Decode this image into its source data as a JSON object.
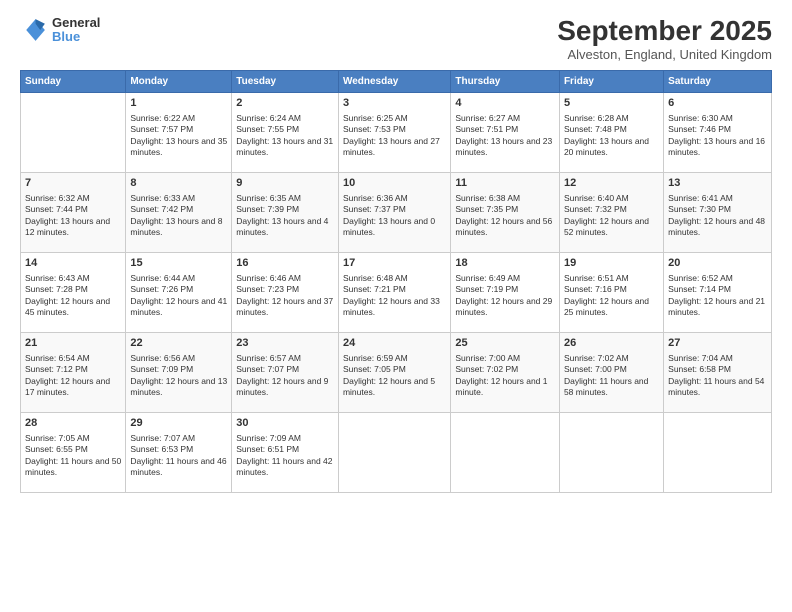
{
  "logo": {
    "line1": "General",
    "line2": "Blue"
  },
  "title": "September 2025",
  "subtitle": "Alveston, England, United Kingdom",
  "days_header": [
    "Sunday",
    "Monday",
    "Tuesday",
    "Wednesday",
    "Thursday",
    "Friday",
    "Saturday"
  ],
  "weeks": [
    [
      {
        "day": "",
        "sunrise": "",
        "sunset": "",
        "daylight": ""
      },
      {
        "day": "1",
        "sunrise": "Sunrise: 6:22 AM",
        "sunset": "Sunset: 7:57 PM",
        "daylight": "Daylight: 13 hours and 35 minutes."
      },
      {
        "day": "2",
        "sunrise": "Sunrise: 6:24 AM",
        "sunset": "Sunset: 7:55 PM",
        "daylight": "Daylight: 13 hours and 31 minutes."
      },
      {
        "day": "3",
        "sunrise": "Sunrise: 6:25 AM",
        "sunset": "Sunset: 7:53 PM",
        "daylight": "Daylight: 13 hours and 27 minutes."
      },
      {
        "day": "4",
        "sunrise": "Sunrise: 6:27 AM",
        "sunset": "Sunset: 7:51 PM",
        "daylight": "Daylight: 13 hours and 23 minutes."
      },
      {
        "day": "5",
        "sunrise": "Sunrise: 6:28 AM",
        "sunset": "Sunset: 7:48 PM",
        "daylight": "Daylight: 13 hours and 20 minutes."
      },
      {
        "day": "6",
        "sunrise": "Sunrise: 6:30 AM",
        "sunset": "Sunset: 7:46 PM",
        "daylight": "Daylight: 13 hours and 16 minutes."
      }
    ],
    [
      {
        "day": "7",
        "sunrise": "Sunrise: 6:32 AM",
        "sunset": "Sunset: 7:44 PM",
        "daylight": "Daylight: 13 hours and 12 minutes."
      },
      {
        "day": "8",
        "sunrise": "Sunrise: 6:33 AM",
        "sunset": "Sunset: 7:42 PM",
        "daylight": "Daylight: 13 hours and 8 minutes."
      },
      {
        "day": "9",
        "sunrise": "Sunrise: 6:35 AM",
        "sunset": "Sunset: 7:39 PM",
        "daylight": "Daylight: 13 hours and 4 minutes."
      },
      {
        "day": "10",
        "sunrise": "Sunrise: 6:36 AM",
        "sunset": "Sunset: 7:37 PM",
        "daylight": "Daylight: 13 hours and 0 minutes."
      },
      {
        "day": "11",
        "sunrise": "Sunrise: 6:38 AM",
        "sunset": "Sunset: 7:35 PM",
        "daylight": "Daylight: 12 hours and 56 minutes."
      },
      {
        "day": "12",
        "sunrise": "Sunrise: 6:40 AM",
        "sunset": "Sunset: 7:32 PM",
        "daylight": "Daylight: 12 hours and 52 minutes."
      },
      {
        "day": "13",
        "sunrise": "Sunrise: 6:41 AM",
        "sunset": "Sunset: 7:30 PM",
        "daylight": "Daylight: 12 hours and 48 minutes."
      }
    ],
    [
      {
        "day": "14",
        "sunrise": "Sunrise: 6:43 AM",
        "sunset": "Sunset: 7:28 PM",
        "daylight": "Daylight: 12 hours and 45 minutes."
      },
      {
        "day": "15",
        "sunrise": "Sunrise: 6:44 AM",
        "sunset": "Sunset: 7:26 PM",
        "daylight": "Daylight: 12 hours and 41 minutes."
      },
      {
        "day": "16",
        "sunrise": "Sunrise: 6:46 AM",
        "sunset": "Sunset: 7:23 PM",
        "daylight": "Daylight: 12 hours and 37 minutes."
      },
      {
        "day": "17",
        "sunrise": "Sunrise: 6:48 AM",
        "sunset": "Sunset: 7:21 PM",
        "daylight": "Daylight: 12 hours and 33 minutes."
      },
      {
        "day": "18",
        "sunrise": "Sunrise: 6:49 AM",
        "sunset": "Sunset: 7:19 PM",
        "daylight": "Daylight: 12 hours and 29 minutes."
      },
      {
        "day": "19",
        "sunrise": "Sunrise: 6:51 AM",
        "sunset": "Sunset: 7:16 PM",
        "daylight": "Daylight: 12 hours and 25 minutes."
      },
      {
        "day": "20",
        "sunrise": "Sunrise: 6:52 AM",
        "sunset": "Sunset: 7:14 PM",
        "daylight": "Daylight: 12 hours and 21 minutes."
      }
    ],
    [
      {
        "day": "21",
        "sunrise": "Sunrise: 6:54 AM",
        "sunset": "Sunset: 7:12 PM",
        "daylight": "Daylight: 12 hours and 17 minutes."
      },
      {
        "day": "22",
        "sunrise": "Sunrise: 6:56 AM",
        "sunset": "Sunset: 7:09 PM",
        "daylight": "Daylight: 12 hours and 13 minutes."
      },
      {
        "day": "23",
        "sunrise": "Sunrise: 6:57 AM",
        "sunset": "Sunset: 7:07 PM",
        "daylight": "Daylight: 12 hours and 9 minutes."
      },
      {
        "day": "24",
        "sunrise": "Sunrise: 6:59 AM",
        "sunset": "Sunset: 7:05 PM",
        "daylight": "Daylight: 12 hours and 5 minutes."
      },
      {
        "day": "25",
        "sunrise": "Sunrise: 7:00 AM",
        "sunset": "Sunset: 7:02 PM",
        "daylight": "Daylight: 12 hours and 1 minute."
      },
      {
        "day": "26",
        "sunrise": "Sunrise: 7:02 AM",
        "sunset": "Sunset: 7:00 PM",
        "daylight": "Daylight: 11 hours and 58 minutes."
      },
      {
        "day": "27",
        "sunrise": "Sunrise: 7:04 AM",
        "sunset": "Sunset: 6:58 PM",
        "daylight": "Daylight: 11 hours and 54 minutes."
      }
    ],
    [
      {
        "day": "28",
        "sunrise": "Sunrise: 7:05 AM",
        "sunset": "Sunset: 6:55 PM",
        "daylight": "Daylight: 11 hours and 50 minutes."
      },
      {
        "day": "29",
        "sunrise": "Sunrise: 7:07 AM",
        "sunset": "Sunset: 6:53 PM",
        "daylight": "Daylight: 11 hours and 46 minutes."
      },
      {
        "day": "30",
        "sunrise": "Sunrise: 7:09 AM",
        "sunset": "Sunset: 6:51 PM",
        "daylight": "Daylight: 11 hours and 42 minutes."
      },
      {
        "day": "",
        "sunrise": "",
        "sunset": "",
        "daylight": ""
      },
      {
        "day": "",
        "sunrise": "",
        "sunset": "",
        "daylight": ""
      },
      {
        "day": "",
        "sunrise": "",
        "sunset": "",
        "daylight": ""
      },
      {
        "day": "",
        "sunrise": "",
        "sunset": "",
        "daylight": ""
      }
    ]
  ]
}
